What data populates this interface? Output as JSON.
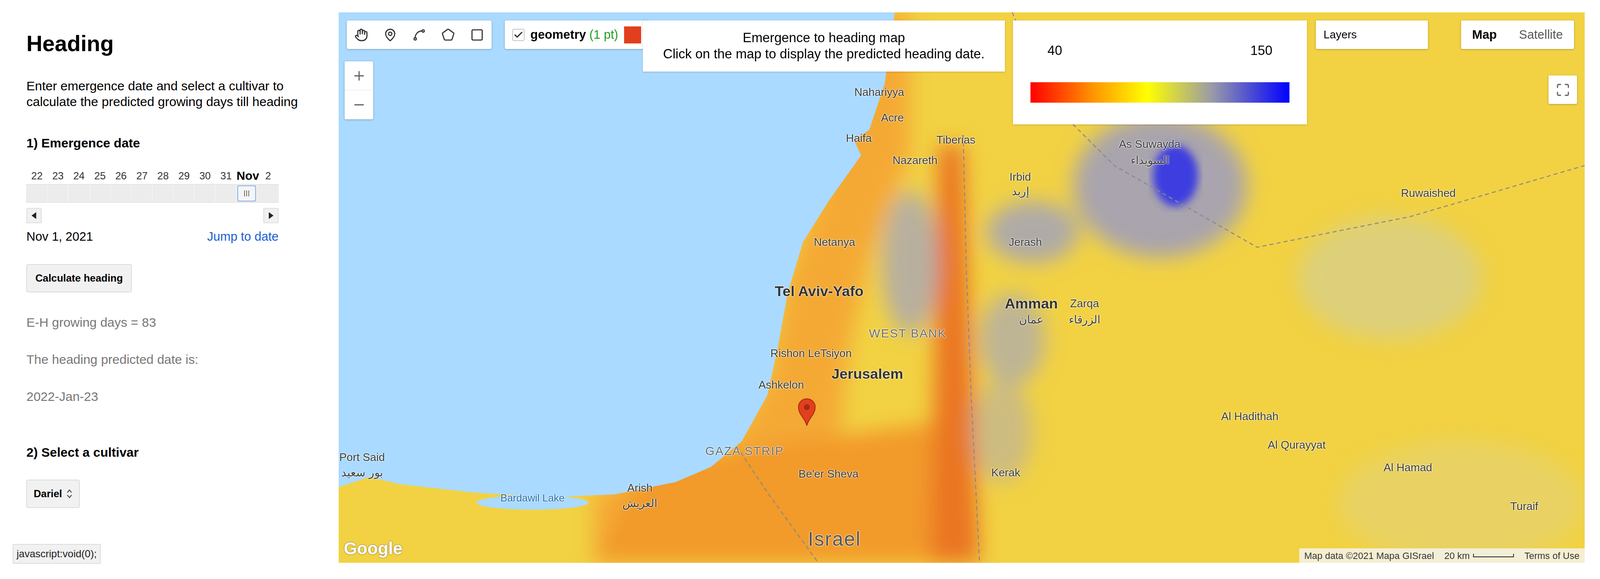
{
  "panel": {
    "title": "Heading",
    "description": "Enter emergence date and select a cultivar to calculate the predicted growing days till heading",
    "emergence": {
      "label": "1) Emergence date",
      "ticks": [
        {
          "label": "22",
          "selected": false
        },
        {
          "label": "23",
          "selected": false
        },
        {
          "label": "24",
          "selected": false
        },
        {
          "label": "25",
          "selected": false
        },
        {
          "label": "26",
          "selected": false
        },
        {
          "label": "27",
          "selected": false
        },
        {
          "label": "28",
          "selected": false
        },
        {
          "label": "29",
          "selected": false
        },
        {
          "label": "30",
          "selected": false
        },
        {
          "label": "31",
          "selected": false
        },
        {
          "label": "Nov",
          "selected": true
        },
        {
          "label": "2",
          "selected": false
        }
      ],
      "value": "Nov 1, 2021",
      "jump": "Jump to date"
    },
    "button": "Calculate heading",
    "growing_days": "E-H growing days = 83",
    "predicted_label": "The heading predicted date is:",
    "predicted_date": "2022-Jan-23",
    "cultivar": {
      "label": "2) Select a cultivar",
      "value": "Dariel"
    }
  },
  "status_bar": "javascript:void(0);",
  "map": {
    "layer": {
      "name": "geometry",
      "count": "(1 pt)",
      "checked": true,
      "color": "#e2401c"
    },
    "info": {
      "title": "Emergence to heading map",
      "hint": "Click on the map to display the predicted heading date."
    },
    "legend": {
      "min": "40",
      "max": "150"
    },
    "layers_button": "Layers",
    "map_types": [
      {
        "label": "Map",
        "selected": true
      },
      {
        "label": "Satellite",
        "selected": false
      }
    ],
    "labels": [
      {
        "text": "Nahariyya",
        "kind": "city"
      },
      {
        "text": "Acre",
        "kind": "city"
      },
      {
        "text": "Haifa",
        "kind": "city"
      },
      {
        "text": "Tiberias",
        "kind": "city"
      },
      {
        "text": "Nazareth",
        "kind": "city"
      },
      {
        "text": "Irbid",
        "kind": "city"
      },
      {
        "text": "إربد",
        "kind": "city"
      },
      {
        "text": "As Suwayda",
        "kind": "city"
      },
      {
        "text": "السويداء",
        "kind": "city"
      },
      {
        "text": "Ruwaished",
        "kind": "city"
      },
      {
        "text": "Netanya",
        "kind": "city"
      },
      {
        "text": "Jerash",
        "kind": "city"
      },
      {
        "text": "Tel Aviv-Yafo",
        "kind": "large"
      },
      {
        "text": "Amman",
        "kind": "large"
      },
      {
        "text": "عمان",
        "kind": "city"
      },
      {
        "text": "Zarqa",
        "kind": "city"
      },
      {
        "text": "الزرقاء",
        "kind": "city"
      },
      {
        "text": "Rishon LeTsiyon",
        "kind": "city"
      },
      {
        "text": "WEST BANK",
        "kind": "region"
      },
      {
        "text": "Jerusalem",
        "kind": "large"
      },
      {
        "text": "Ashkelon",
        "kind": "city"
      },
      {
        "text": "GAZA STRIP",
        "kind": "region"
      },
      {
        "text": "Be'er Sheva",
        "kind": "city"
      },
      {
        "text": "Port Said",
        "kind": "city"
      },
      {
        "text": "بور سعيد",
        "kind": "city"
      },
      {
        "text": "Arish",
        "kind": "city"
      },
      {
        "text": "العريش",
        "kind": "city"
      },
      {
        "text": "Bardawil Lake",
        "kind": "water"
      },
      {
        "text": "Kerak",
        "kind": "city"
      },
      {
        "text": "Israel",
        "kind": "country"
      },
      {
        "text": "Al Hadithah",
        "kind": "city"
      },
      {
        "text": "Al Qurayyat",
        "kind": "city"
      },
      {
        "text": "Al Hamad",
        "kind": "city"
      },
      {
        "text": "Turaif",
        "kind": "city"
      }
    ],
    "google": "Google",
    "attribution": [
      "Map data ©2021 Mapa GISrael",
      "20 km",
      "Terms of Use"
    ]
  }
}
